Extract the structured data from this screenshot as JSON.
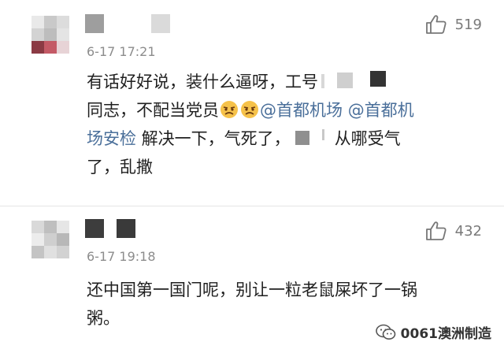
{
  "comments": [
    {
      "time": "6-17 17:21",
      "likes": "519",
      "lines": [
        {
          "t1": "有话好好说，装什么逼呀，工号"
        },
        {
          "t1": "同志，不配当党员",
          "m1": "@首都机场",
          "m2": "@首都机"
        },
        {
          "m1": "场安检",
          "t1": " 解决一下，气死了，",
          "t2": "从哪受气"
        },
        {
          "t1": "了，乱撒"
        }
      ]
    },
    {
      "time": "6-17 19:18",
      "likes": "432",
      "lines": [
        {
          "t1": "还中国第一国门呢，别让一粒老鼠屎坏了一锅"
        },
        {
          "t1": "粥。"
        }
      ]
    }
  ],
  "watermark": {
    "text": "0061澳洲制造",
    "icon": "wechat-icon"
  },
  "icons": {
    "like": "thumbs-up-icon",
    "emoji": "angry-face-emoji"
  },
  "colors": {
    "mention": "#4a6f9a",
    "timestamp": "#8c8c8c",
    "likes": "#7a7a7a"
  }
}
